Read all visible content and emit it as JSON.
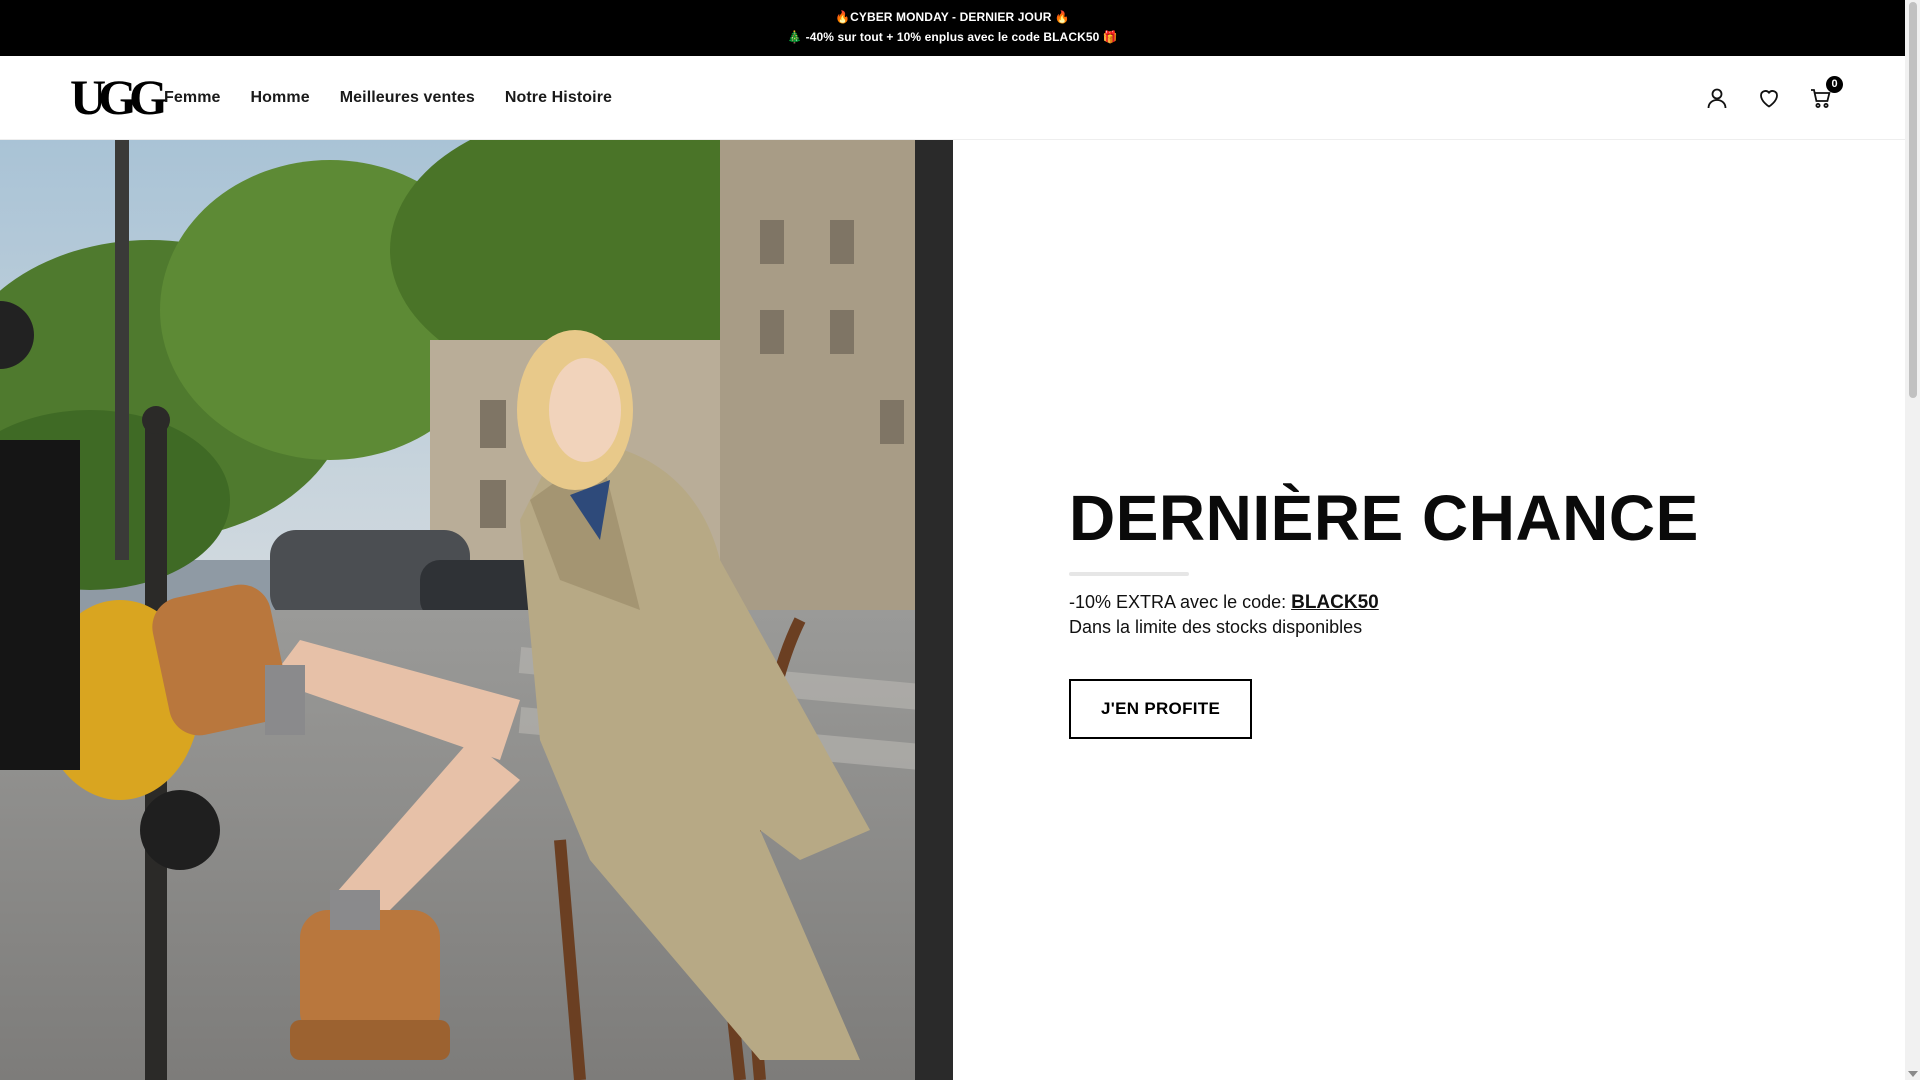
{
  "announcement": {
    "line1": "🔥CYBER MONDAY - DERNIER JOUR 🔥",
    "line2": "🎄 -40% sur tout + 10% enplus avec le code BLACK50 🎁"
  },
  "header": {
    "logo_text": "UGG",
    "nav": [
      {
        "label": "Femme"
      },
      {
        "label": "Homme"
      },
      {
        "label": "Meilleures ventes"
      },
      {
        "label": "Notre Histoire"
      }
    ],
    "icons": {
      "account": "account-icon",
      "wishlist": "heart-icon",
      "cart": "cart-icon"
    },
    "cart_count": "0"
  },
  "hero": {
    "title": "DERNIÈRE CHANCE",
    "subtitle_prefix": "-10% EXTRA avec le code: ",
    "promo_code": "BLACK50",
    "note": "Dans la limite des stocks disponibles",
    "cta_label": "J'EN PROFITE"
  },
  "colors": {
    "announcement_bg": "#000000",
    "text": "#111111",
    "background": "#ffffff"
  }
}
